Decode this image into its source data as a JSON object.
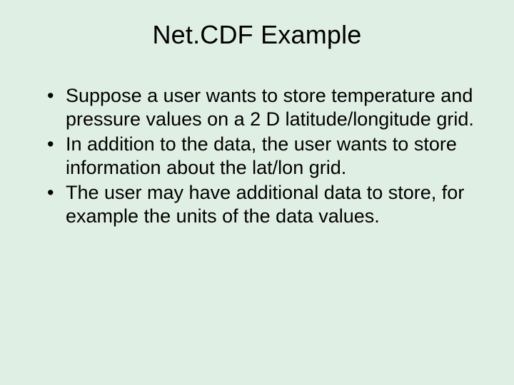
{
  "slide": {
    "title": "Net.CDF Example",
    "bullets": [
      "Suppose a user wants to store temperature and pressure values on a 2 D latitude/longitude grid.",
      "In addition to the data, the user wants to store information about the lat/lon grid.",
      "The user may have additional data to store, for example the units of the data values."
    ]
  }
}
